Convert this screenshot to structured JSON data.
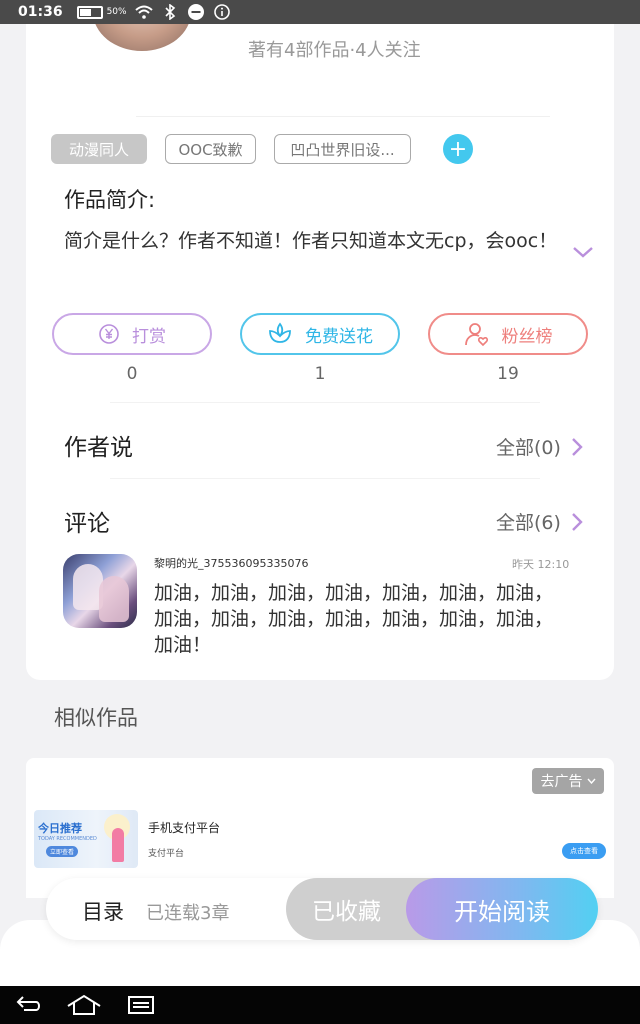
{
  "status_bar": {
    "time": "01:36",
    "battery": "50%",
    "battery_level": 0.5
  },
  "author": {
    "works_info": "著有4部作品·4人关注"
  },
  "tags": [
    "动漫同人",
    "OOC致歉",
    "凹凸世界旧设..."
  ],
  "intro": {
    "label": "作品简介:",
    "text": "简介是什么？作者不知道！作者只知道本文无cp，会ooc！"
  },
  "actions": [
    {
      "label": "打赏",
      "count": "0",
      "icon": "yen-coin-icon",
      "color": "#b98fdc"
    },
    {
      "label": "免费送花",
      "count": "1",
      "icon": "flower-icon",
      "color": "#2fb6e6"
    },
    {
      "label": "粉丝榜",
      "count": "19",
      "icon": "fan-user-icon",
      "color": "#ee7f7c"
    }
  ],
  "author_says": {
    "title": "作者说",
    "all_label": "全部(0)"
  },
  "comments": {
    "title": "评论",
    "all_label": "全部(6)",
    "items": [
      {
        "user": "黎明的光_375536095335076",
        "time": "昨天 12:10",
        "text": "加油，加油，加油，加油，加油，加油，加油，加油，加油，加油，加油，加油，加油，加油，加油！"
      }
    ]
  },
  "similar": {
    "title": "相似作品"
  },
  "ad": {
    "remove_label": "去广告",
    "thumb_title": "今日推荐",
    "thumb_sub": "TODAY RECOMMENDED",
    "thumb_cta": "立即查看",
    "title": "手机支付平台",
    "subtitle": "支付平台",
    "button": "点击查看"
  },
  "bottom_bar": {
    "toc": "目录",
    "serial_status": "已连载3章",
    "collected": "已收藏",
    "start_reading": "开始阅读"
  },
  "colors": {
    "accent_blue": "#43c8ee",
    "read_gradient_start": "#b99ae8",
    "read_gradient_end": "#52d0f2"
  }
}
